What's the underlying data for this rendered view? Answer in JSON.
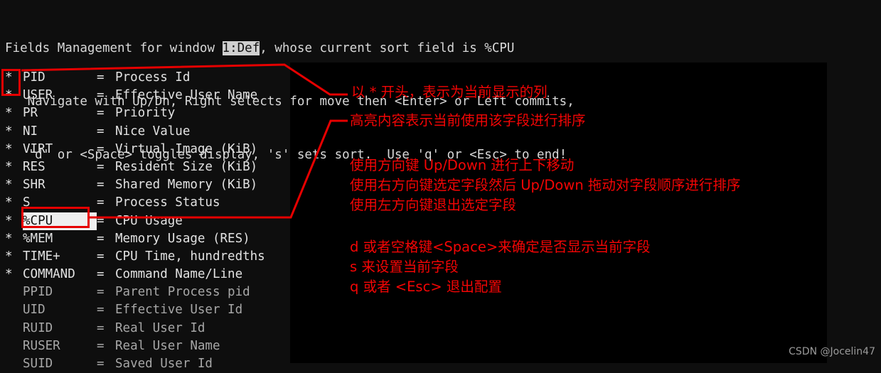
{
  "terminal": {
    "header": {
      "line1_a": "Fields Management for window ",
      "line1_highlight": "1:Def",
      "line1_b": ", whose current sort field is %CPU",
      "line2": "   Navigate with Up/Dn, Right selects for move then <Enter> or Left commits,",
      "line3": "   'd' or <Space> toggles display, 's' sets sort.  Use 'q' or <Esc> to end!"
    },
    "fields": [
      {
        "star": "*",
        "name": "PID",
        "eq": "=",
        "desc": "Process Id",
        "displayed": true,
        "sorted": false
      },
      {
        "star": "*",
        "name": "USER",
        "eq": "=",
        "desc": "Effective User Name",
        "displayed": true,
        "sorted": false
      },
      {
        "star": "*",
        "name": "PR",
        "eq": "=",
        "desc": "Priority",
        "displayed": true,
        "sorted": false
      },
      {
        "star": "*",
        "name": "NI",
        "eq": "=",
        "desc": "Nice Value",
        "displayed": true,
        "sorted": false
      },
      {
        "star": "*",
        "name": "VIRT",
        "eq": "=",
        "desc": "Virtual Image (KiB)",
        "displayed": true,
        "sorted": false
      },
      {
        "star": "*",
        "name": "RES",
        "eq": "=",
        "desc": "Resident Size (KiB)",
        "displayed": true,
        "sorted": false
      },
      {
        "star": "*",
        "name": "SHR",
        "eq": "=",
        "desc": "Shared Memory (KiB)",
        "displayed": true,
        "sorted": false
      },
      {
        "star": "*",
        "name": "S",
        "eq": "=",
        "desc": "Process Status",
        "displayed": true,
        "sorted": false
      },
      {
        "star": "*",
        "name": "%CPU",
        "eq": "=",
        "desc": "CPU Usage",
        "displayed": true,
        "sorted": true
      },
      {
        "star": "*",
        "name": "%MEM",
        "eq": "=",
        "desc": "Memory Usage (RES)",
        "displayed": true,
        "sorted": false
      },
      {
        "star": "*",
        "name": "TIME+",
        "eq": "=",
        "desc": "CPU Time, hundredths",
        "displayed": true,
        "sorted": false
      },
      {
        "star": "*",
        "name": "COMMAND",
        "eq": "=",
        "desc": "Command Name/Line",
        "displayed": true,
        "sorted": false
      },
      {
        "star": " ",
        "name": "PPID",
        "eq": "=",
        "desc": "Parent Process pid",
        "displayed": false,
        "sorted": false
      },
      {
        "star": " ",
        "name": "UID",
        "eq": "=",
        "desc": "Effective User Id",
        "displayed": false,
        "sorted": false
      },
      {
        "star": " ",
        "name": "RUID",
        "eq": "=",
        "desc": "Real User Id",
        "displayed": false,
        "sorted": false
      },
      {
        "star": " ",
        "name": "RUSER",
        "eq": "=",
        "desc": "Real User Name",
        "displayed": false,
        "sorted": false
      },
      {
        "star": " ",
        "name": "SUID",
        "eq": "=",
        "desc": "Saved User Id",
        "displayed": false,
        "sorted": false
      }
    ]
  },
  "annotations": {
    "star_meaning": "以 * 开头，表示为当前显示的列",
    "sorted_meaning": "高亮内容表示当前使用该字段进行排序",
    "navigation": [
      "使用方向键 Up/Down 进行上下移动",
      "使用右方向键选定字段然后 Up/Down 拖动对字段顺序进行排序",
      "使用左方向键退出选定字段"
    ],
    "keys": [
      "d 或者空格键<Space>来确定是否显示当前字段",
      "s 来设置当前字段",
      "q 或者 <Esc> 退出配置"
    ]
  },
  "watermark": "CSDN @Jocelin47",
  "colors": {
    "annotation_red": "#f40505",
    "terminal_bg": "#000000",
    "panel_bg": "#0e0e0e",
    "terminal_fg": "#d8d8d8",
    "highlight_bg": "#efefef"
  }
}
